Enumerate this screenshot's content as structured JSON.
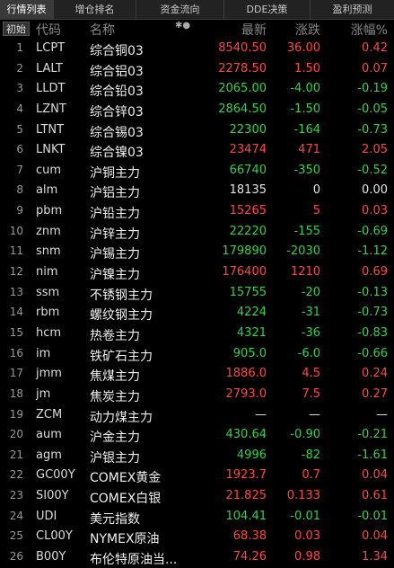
{
  "tabs": [
    "行情列表",
    "增仓排名",
    "资金流向",
    "DDE决策",
    "盈利预测"
  ],
  "header": {
    "init": "初始",
    "code": "代码",
    "name": "名称",
    "dots": "✱●",
    "price": "最新",
    "change": "涨跌",
    "percent": "涨幅%"
  },
  "colors": {
    "up": "#ff4747",
    "down": "#35d14a",
    "flat": "#e6e6e6"
  },
  "rows": [
    {
      "idx": "1",
      "code": "LCPT",
      "name": "综合铜03",
      "price": "8540.50",
      "change": "36.00",
      "percent": "0.42",
      "dir": "up"
    },
    {
      "idx": "2",
      "code": "LALT",
      "name": "综合铝03",
      "price": "2278.50",
      "change": "1.50",
      "percent": "0.07",
      "dir": "up"
    },
    {
      "idx": "3",
      "code": "LLDT",
      "name": "综合铅03",
      "price": "2065.00",
      "change": "-4.00",
      "percent": "-0.19",
      "dir": "dn"
    },
    {
      "idx": "4",
      "code": "LZNT",
      "name": "综合锌03",
      "price": "2864.50",
      "change": "-1.50",
      "percent": "-0.05",
      "dir": "dn"
    },
    {
      "idx": "5",
      "code": "LTNT",
      "name": "综合锡03",
      "price": "22300",
      "change": "-164",
      "percent": "-0.73",
      "dir": "dn"
    },
    {
      "idx": "6",
      "code": "LNKT",
      "name": "综合镍03",
      "price": "23474",
      "change": "471",
      "percent": "2.05",
      "dir": "up"
    },
    {
      "idx": "7",
      "code": "cum",
      "name": "沪铜主力",
      "price": "66740",
      "change": "-350",
      "percent": "-0.52",
      "dir": "dn"
    },
    {
      "idx": "8",
      "code": "alm",
      "name": "沪铝主力",
      "price": "18135",
      "change": "0",
      "percent": "0.00",
      "dir": "fl"
    },
    {
      "idx": "9",
      "code": "pbm",
      "name": "沪铅主力",
      "price": "15265",
      "change": "5",
      "percent": "0.03",
      "dir": "up"
    },
    {
      "idx": "10",
      "code": "znm",
      "name": "沪锌主力",
      "price": "22220",
      "change": "-155",
      "percent": "-0.69",
      "dir": "dn"
    },
    {
      "idx": "11",
      "code": "snm",
      "name": "沪锡主力",
      "price": "179890",
      "change": "-2030",
      "percent": "-1.12",
      "dir": "dn"
    },
    {
      "idx": "12",
      "code": "nim",
      "name": "沪镍主力",
      "price": "176400",
      "change": "1210",
      "percent": "0.69",
      "dir": "up"
    },
    {
      "idx": "13",
      "code": "ssm",
      "name": "不锈钢主力",
      "price": "15755",
      "change": "-20",
      "percent": "-0.13",
      "dir": "dn"
    },
    {
      "idx": "14",
      "code": "rbm",
      "name": "螺纹钢主力",
      "price": "4224",
      "change": "-31",
      "percent": "-0.73",
      "dir": "dn"
    },
    {
      "idx": "15",
      "code": "hcm",
      "name": "热卷主力",
      "price": "4321",
      "change": "-36",
      "percent": "-0.83",
      "dir": "dn"
    },
    {
      "idx": "16",
      "code": "im",
      "name": "铁矿石主力",
      "price": "905.0",
      "change": "-6.0",
      "percent": "-0.66",
      "dir": "dn"
    },
    {
      "idx": "17",
      "code": "jmm",
      "name": "焦煤主力",
      "price": "1886.0",
      "change": "4.5",
      "percent": "0.24",
      "dir": "up"
    },
    {
      "idx": "18",
      "code": "jm",
      "name": "焦炭主力",
      "price": "2793.0",
      "change": "7.5",
      "percent": "0.27",
      "dir": "up"
    },
    {
      "idx": "19",
      "code": "ZCM",
      "name": "动力煤主力",
      "price": "—",
      "change": "—",
      "percent": "—",
      "dir": "fl"
    },
    {
      "idx": "20",
      "code": "aum",
      "name": "沪金主力",
      "price": "430.64",
      "change": "-0.90",
      "percent": "-0.21",
      "dir": "dn"
    },
    {
      "idx": "21",
      "code": "agm",
      "name": "沪银主力",
      "price": "4996",
      "change": "-82",
      "percent": "-1.61",
      "dir": "dn"
    },
    {
      "idx": "22",
      "code": "GC00Y",
      "name": "COMEX黄金",
      "price": "1923.7",
      "change": "0.7",
      "percent": "0.04",
      "dir": "up"
    },
    {
      "idx": "23",
      "code": "SI00Y",
      "name": "COMEX白银",
      "price": "21.825",
      "change": "0.133",
      "percent": "0.61",
      "dir": "up"
    },
    {
      "idx": "24",
      "code": "UDI",
      "name": "美元指数",
      "price": "104.41",
      "change": "-0.01",
      "percent": "-0.01",
      "dir": "dn"
    },
    {
      "idx": "25",
      "code": "CL00Y",
      "name": "NYMEX原油",
      "price": "68.38",
      "change": "0.03",
      "percent": "0.04",
      "dir": "up"
    },
    {
      "idx": "26",
      "code": "B00Y",
      "name": "布伦特原油当...",
      "price": "74.26",
      "change": "0.98",
      "percent": "1.34",
      "dir": "up"
    }
  ]
}
